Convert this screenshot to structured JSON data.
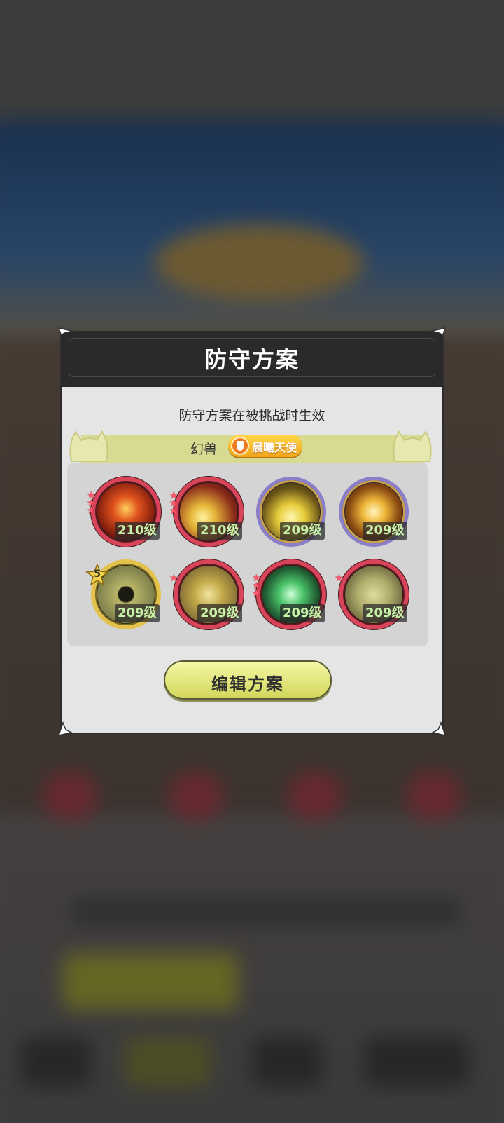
{
  "dialog": {
    "title": "防守方案",
    "subtitle": "防守方案在被挑战时生效",
    "beast_label": "幻兽",
    "beast_name": "晨曦天使",
    "edit_button": "编辑方案"
  },
  "skills": [
    {
      "level": "210级",
      "stars": 3,
      "ring": "red",
      "theme": "fire"
    },
    {
      "level": "210级",
      "stars": 3,
      "ring": "red",
      "theme": "gold-sparkle"
    },
    {
      "level": "209级",
      "stars": 0,
      "ring": "rainbow",
      "theme": "lightning-orb"
    },
    {
      "level": "209级",
      "stars": 0,
      "ring": "rainbow",
      "theme": "gold-burst"
    },
    {
      "level": "209级",
      "stars": 0,
      "ring": "gold",
      "theme": "heal-orb",
      "star_badge": "5"
    },
    {
      "level": "209级",
      "stars": 1,
      "ring": "red",
      "theme": "shield"
    },
    {
      "level": "209级",
      "stars": 3,
      "ring": "red",
      "theme": "green-claw"
    },
    {
      "level": "209级",
      "stars": 1,
      "ring": "red",
      "theme": "scorpion"
    }
  ],
  "colors": {
    "header_bg": "#2a2a2a",
    "dialog_bg": "#e5e5e5",
    "beast_bar": "#d8da92",
    "button": "#e6e982",
    "level_text": "#c8f0a8"
  }
}
